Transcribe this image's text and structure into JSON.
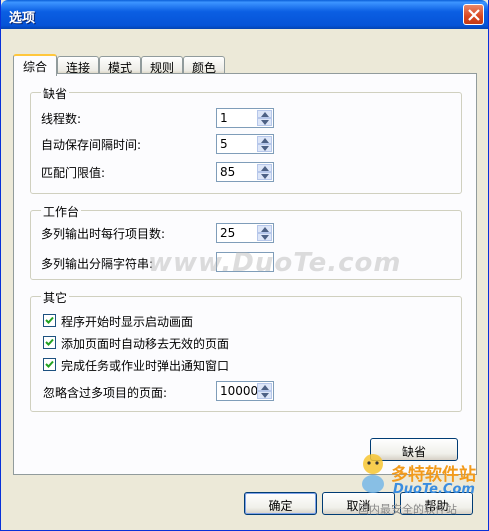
{
  "window": {
    "title": "选项"
  },
  "tabs": [
    "综合",
    "连接",
    "模式",
    "规则",
    "颜色"
  ],
  "groups": {
    "defaults": {
      "title": "缺省",
      "rows": [
        {
          "label": "线程数:",
          "value": "1"
        },
        {
          "label": "自动保存间隔时间:",
          "value": "5"
        },
        {
          "label": "匹配门限值:",
          "value": "85"
        }
      ]
    },
    "workbench": {
      "title": "工作台",
      "rows": [
        {
          "label": "多列输出时每行项目数:",
          "value": "25"
        },
        {
          "label": "多列输出分隔字符串:",
          "value": ""
        }
      ]
    },
    "other": {
      "title": "其它",
      "checks": [
        {
          "label": "程序开始时显示启动画面",
          "checked": true
        },
        {
          "label": "添加页面时自动移去无效的页面",
          "checked": true
        },
        {
          "label": "完成任务或作业时弹出通知窗口",
          "checked": true
        }
      ],
      "ignore_label": "忽略含过多项目的页面:",
      "ignore_value": "10000"
    }
  },
  "buttons": {
    "defaults": "缺省",
    "ok": "确定",
    "cancel": "取消",
    "help": "帮助"
  },
  "watermark": "www.DuoTe.com",
  "logo": {
    "cn": "多特软件站",
    "en": "DuoTe.Com",
    "tag": "国内最安全的软件站"
  },
  "colors": {
    "titlebar": "#0553d7",
    "face": "#ece9d8",
    "active_tab_accent": "#ffc73c"
  }
}
